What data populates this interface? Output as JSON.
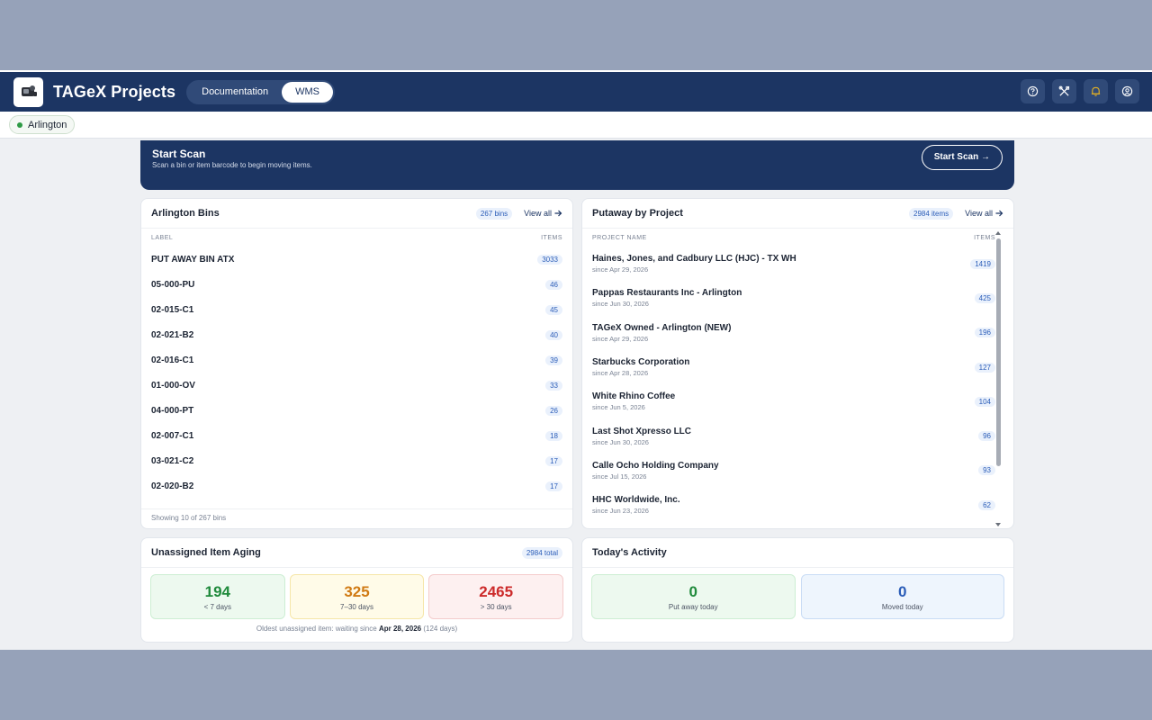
{
  "app": {
    "title": "TAGeX Projects",
    "tabs": [
      {
        "label": "Documentation",
        "active": false
      },
      {
        "label": "WMS",
        "active": true
      }
    ],
    "actions": [
      "help-icon",
      "tools-icon",
      "bell-icon",
      "account-icon"
    ]
  },
  "site": {
    "name": "Arlington"
  },
  "scan": {
    "title": "Start Scan",
    "subtitle": "Scan a bin or item barcode to begin moving items.",
    "button": "Start Scan →"
  },
  "bins": {
    "title": "Arlington Bins",
    "badge": "267 bins",
    "view_all": "View all",
    "col_label": "LABEL",
    "col_items": "ITEMS",
    "rows": [
      {
        "label": "PUT AWAY BIN ATX",
        "items": "3033"
      },
      {
        "label": "05-000-PU",
        "items": "46"
      },
      {
        "label": "02-015-C1",
        "items": "45"
      },
      {
        "label": "02-021-B2",
        "items": "40"
      },
      {
        "label": "02-016-C1",
        "items": "39"
      },
      {
        "label": "01-000-OV",
        "items": "33"
      },
      {
        "label": "04-000-PT",
        "items": "26"
      },
      {
        "label": "02-007-C1",
        "items": "18"
      },
      {
        "label": "03-021-C2",
        "items": "17"
      },
      {
        "label": "02-020-B2",
        "items": "17"
      }
    ],
    "footer": "Showing 10 of 267 bins"
  },
  "putaway": {
    "title": "Putaway by Project",
    "badge": "2984 items",
    "view_all": "View all",
    "col_name": "PROJECT NAME",
    "col_items": "ITEMS",
    "rows": [
      {
        "name": "Haines, Jones, and Cadbury LLC (HJC) - TX WH",
        "since": "since Apr 29, 2026",
        "items": "1419"
      },
      {
        "name": "Pappas Restaurants Inc - Arlington",
        "since": "since Jun 30, 2026",
        "items": "425"
      },
      {
        "name": "TAGeX Owned - Arlington (NEW)",
        "since": "since Apr 29, 2026",
        "items": "196"
      },
      {
        "name": "Starbucks Corporation",
        "since": "since Apr 28, 2026",
        "items": "127"
      },
      {
        "name": "White Rhino Coffee",
        "since": "since Jun 5, 2026",
        "items": "104"
      },
      {
        "name": "Last Shot Xpresso LLC",
        "since": "since Jun 30, 2026",
        "items": "96"
      },
      {
        "name": "Calle Ocho Holding Company",
        "since": "since Jul 15, 2026",
        "items": "93"
      },
      {
        "name": "HHC Worldwide, Inc.",
        "since": "since Jun 23, 2026",
        "items": "62"
      }
    ]
  },
  "aging": {
    "title": "Unassigned Item Aging",
    "badge": "2984 total",
    "buckets": [
      {
        "value": "194",
        "label": "< 7 days"
      },
      {
        "value": "325",
        "label": "7–30 days"
      },
      {
        "value": "2465",
        "label": "> 30 days"
      }
    ],
    "note_prefix": "Oldest unassigned item: waiting since",
    "note_date": "Apr 28, 2026",
    "note_suffix": "(124 days)"
  },
  "activity": {
    "title": "Today's Activity",
    "put_away_value": "0",
    "put_away_label": "Put away today",
    "moved_value": "0",
    "moved_label": "Moved today"
  },
  "colors": {
    "navy": "#1c3563",
    "accent_blue": "#2b5db8",
    "green": "#1f8a3b",
    "amber": "#d07a13",
    "red": "#cc2a2a"
  }
}
